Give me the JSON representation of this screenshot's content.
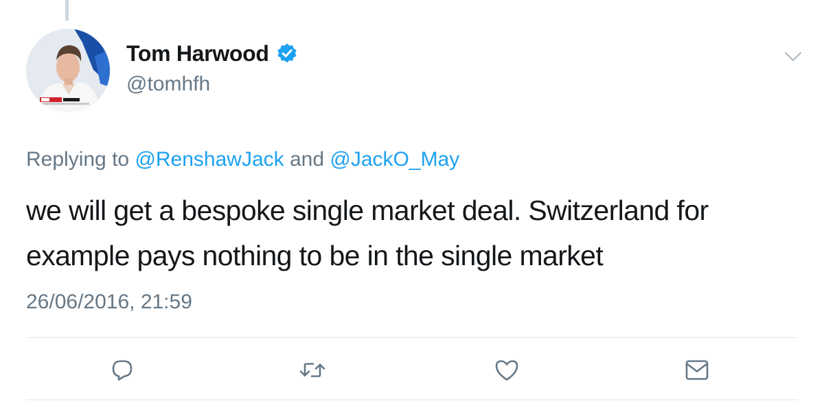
{
  "author": {
    "display_name": "Tom Harwood",
    "handle": "@tomhfh",
    "verified": true,
    "avatar_icon": "profile-photo"
  },
  "reply_context": {
    "prefix": "Replying to",
    "mention_1": "@RenshawJack",
    "conjunction": "and",
    "mention_2": "@JackO_May"
  },
  "tweet": {
    "text": "we will get a bespoke single market deal. Switzerland for example pays nothing to be in the single market",
    "timestamp": "26/06/2016, 21:59"
  },
  "actions": [
    {
      "name": "reply",
      "icon": "reply-icon"
    },
    {
      "name": "retweet",
      "icon": "retweet-icon"
    },
    {
      "name": "like",
      "icon": "heart-icon"
    },
    {
      "name": "direct-message",
      "icon": "envelope-icon"
    }
  ],
  "colors": {
    "accent": "#1da1f2",
    "secondary_text": "#657786",
    "primary_text": "#14171a",
    "icon": "#657786"
  }
}
